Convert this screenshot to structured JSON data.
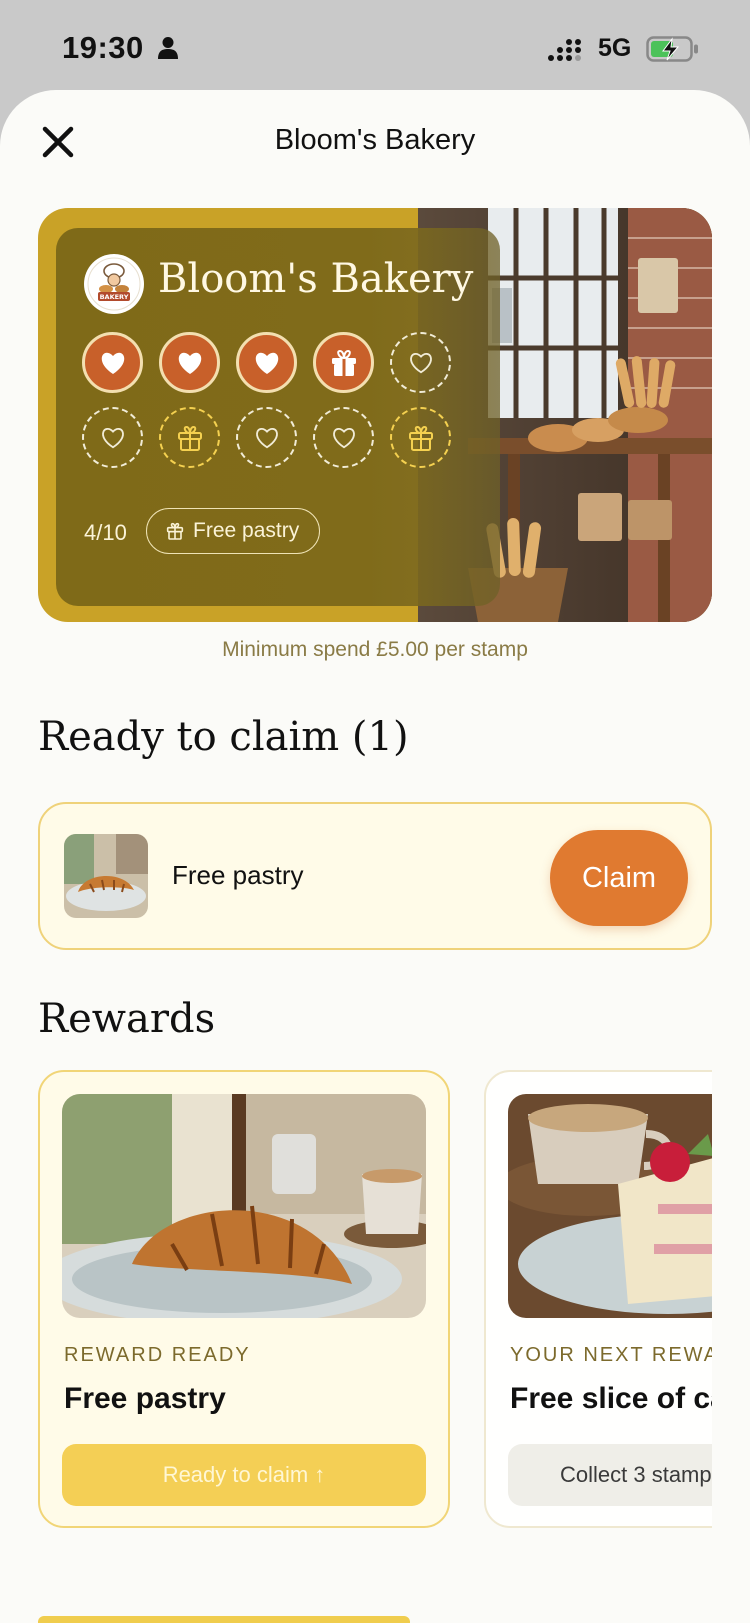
{
  "status_bar": {
    "time": "19:30",
    "network": "5G"
  },
  "header": {
    "title": "Bloom's Bakery"
  },
  "loyalty_card": {
    "name": "Bloom's Bakery",
    "stamps_collected": 4,
    "stamps_total": 10,
    "progress_text": "4/10",
    "reward_pill": "Free pastry",
    "stamp_slots": [
      "heart",
      "heart",
      "heart",
      "gift",
      "heart",
      "heart",
      "gift",
      "heart",
      "heart",
      "gift"
    ],
    "colors": {
      "card": "#c9a227",
      "panel": "#806b1a",
      "filled_stamp": "#c8602a"
    }
  },
  "min_spend": "Minimum spend £5.00 per stamp",
  "ready_section": {
    "title": "Ready to claim (1)",
    "item_label": "Free pastry",
    "claim_button": "Claim"
  },
  "rewards_section": {
    "title": "Rewards",
    "cards": [
      {
        "kicker": "REWARD READY",
        "title": "Free pastry",
        "button": "Ready to claim ↑"
      },
      {
        "kicker": "YOUR NEXT REWA",
        "title": "Free slice of ca",
        "button": "Collect 3 stamp"
      }
    ]
  },
  "colors": {
    "accent": "#e07a30",
    "gold": "#f4cf55",
    "background": "#fbfbf8"
  }
}
